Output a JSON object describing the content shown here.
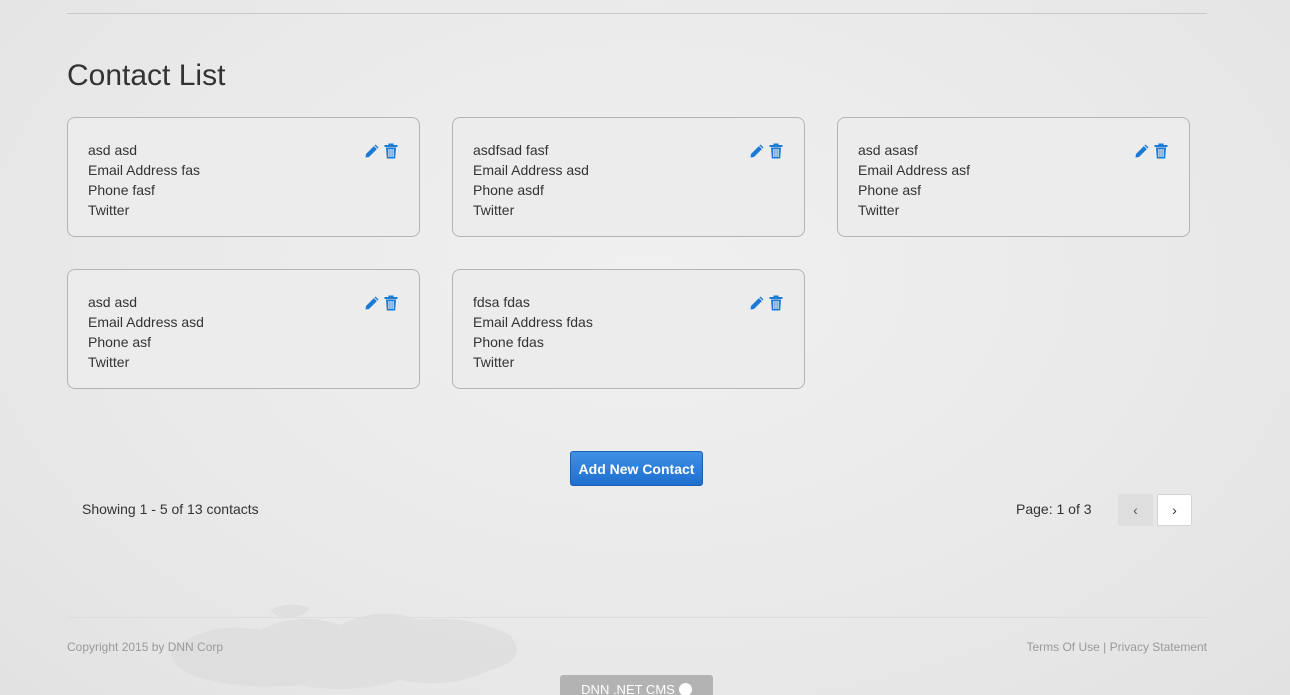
{
  "page": {
    "title": "Contact List"
  },
  "colors": {
    "accent": "#1a7ad4",
    "button": "#2f7fdc",
    "card_border": "#b4b4b4"
  },
  "icons": {
    "edit": "pencil-icon",
    "delete": "trash-icon"
  },
  "contacts": [
    {
      "name": "asd asd",
      "email": "Email Address fas",
      "phone": "Phone fasf",
      "twitter": "Twitter"
    },
    {
      "name": "asdfsad fasf",
      "email": "Email Address asd",
      "phone": "Phone asdf",
      "twitter": "Twitter"
    },
    {
      "name": "asd asasf",
      "email": "Email Address asf",
      "phone": "Phone asf",
      "twitter": "Twitter"
    },
    {
      "name": "asd asd",
      "email": "Email Address asd",
      "phone": "Phone asf",
      "twitter": "Twitter"
    },
    {
      "name": "fdsa fdas",
      "email": "Email Address fdas",
      "phone": "Phone fdas",
      "twitter": "Twitter"
    }
  ],
  "actions": {
    "add_label": "Add New Contact"
  },
  "pagination": {
    "showing": "Showing 1 - 5 of 13 contacts",
    "page_info": "Page: 1 of 3",
    "prev": "‹",
    "next": "›"
  },
  "footer": {
    "copyright": "Copyright 2015 by DNN Corp",
    "terms": "Terms Of Use",
    "separator": "|",
    "privacy": "Privacy Statement",
    "badge": "DNN .NET CMS"
  }
}
